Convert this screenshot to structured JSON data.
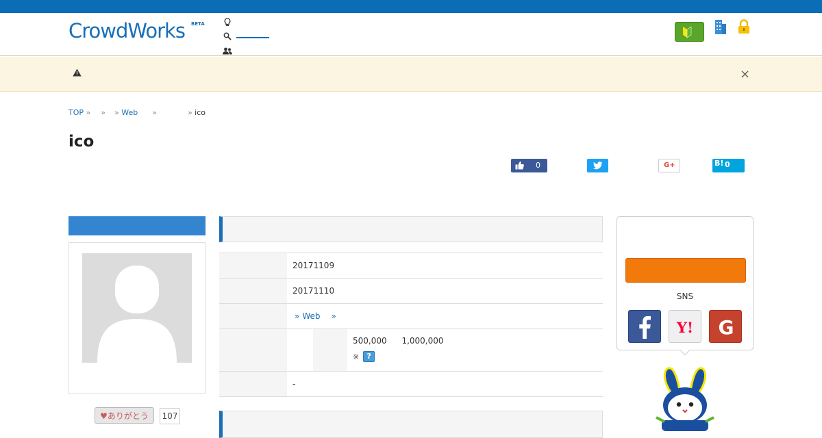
{
  "topbar": {
    "text": ""
  },
  "header": {
    "logo": "CrowdWorks",
    "logo_badge": "BETA",
    "nav": [
      {
        "icon": "lightbulb-icon",
        "label": ""
      },
      {
        "icon": "search-icon",
        "label": ""
      },
      {
        "icon": "users-icon",
        "label": ""
      }
    ],
    "beginner_label": "",
    "login_links": ""
  },
  "alert": {
    "icon": "warning-icon",
    "message": "",
    "close": "×"
  },
  "breadcrumb": [
    {
      "label": "TOP"
    },
    {
      "label": ""
    },
    {
      "label": ""
    },
    {
      "label": "Web"
    },
    {
      "label": ""
    },
    {
      "label": "ico"
    }
  ],
  "breadcrumb_sep": "»",
  "page_title": "ico",
  "share": {
    "facebook_count": "0",
    "hatena_label": "B!",
    "hatena_count": "0",
    "google_label": "G+"
  },
  "client": {
    "thanks_label": "♥ありがとう",
    "thanks_count": "107"
  },
  "details": {
    "rows": [
      {
        "key": "",
        "value": "20171109"
      },
      {
        "key": "",
        "value": "20171110"
      },
      {
        "key": "",
        "value_prefix": "»",
        "value_link": "Web",
        "value_suffix": "»"
      },
      {
        "key": "",
        "sub_key": "",
        "min": "500,000",
        "max": "1,000,000",
        "note": "※"
      },
      {
        "key": "",
        "value": "-"
      }
    ],
    "help_icon": "?"
  },
  "sidebar": {
    "sns_label": "SNS"
  },
  "colors": {
    "brand": "#1a6fb6",
    "cta": "#f27a0b",
    "alert_bg": "#fcf5e1"
  }
}
